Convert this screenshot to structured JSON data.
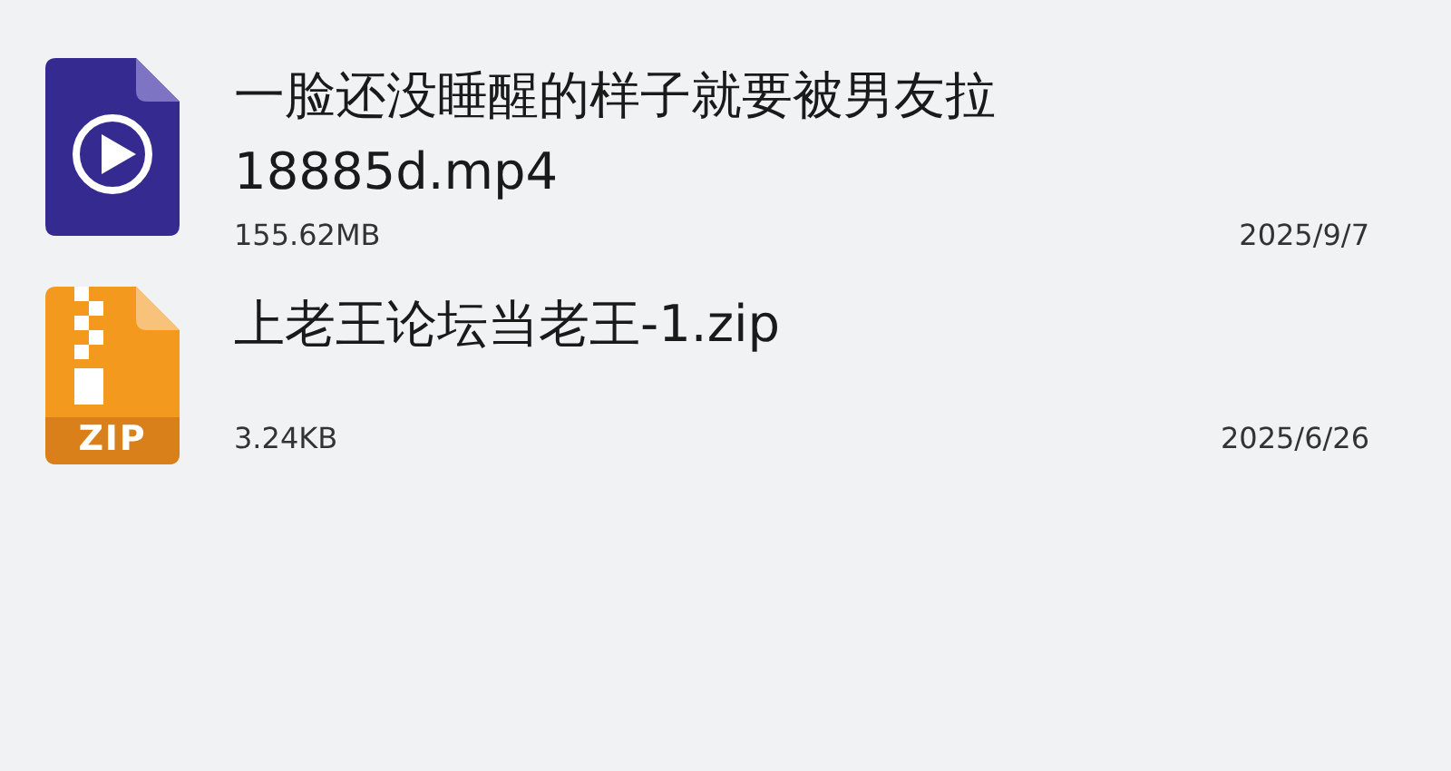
{
  "files": [
    {
      "kind": "video",
      "name_lines": [
        "一脸还没睡醒的样子就要被男友拉",
        "18885d.mp4"
      ],
      "size": "155.62MB",
      "date": "2025/9/7"
    },
    {
      "kind": "zip",
      "badge": "ZIP",
      "name_lines": [
        "上老王论坛当老王-1.zip"
      ],
      "size": "3.24KB",
      "date": "2025/6/26"
    }
  ]
}
